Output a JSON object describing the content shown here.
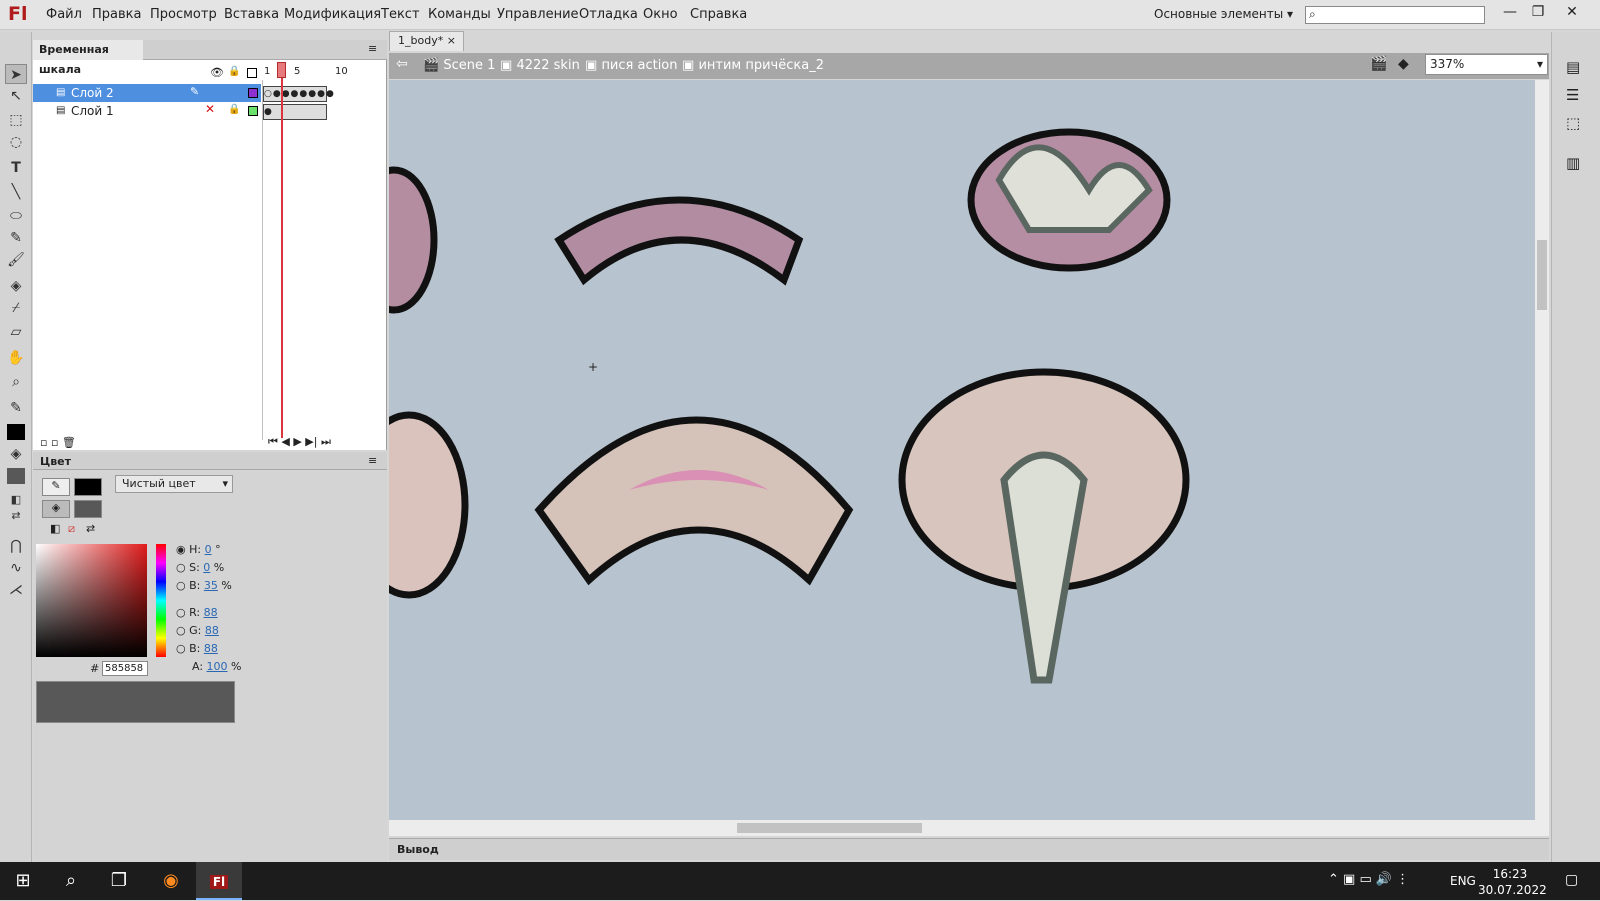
{
  "app": {
    "logo": "Fl"
  },
  "menu": [
    "Файл",
    "Правка",
    "Просмотр",
    "Вставка",
    "Модификация",
    "Текст",
    "Команды",
    "Управление",
    "Отладка",
    "Окно",
    "Справка"
  ],
  "workspace": "Основные элементы",
  "timeline": {
    "title": "Временная шкала",
    "frame_ruler": [
      "1",
      "5",
      "10"
    ],
    "layers": [
      {
        "name": "Слой 2",
        "selected": true
      },
      {
        "name": "Слой 1",
        "selected": false
      }
    ]
  },
  "color_panel": {
    "title": "Цвет",
    "fill_type": "Чистый цвет",
    "hsb": {
      "H": "0",
      "S": "0",
      "B": "35"
    },
    "rgb": {
      "R": "88",
      "G": "88",
      "B": "88"
    },
    "alpha": "100",
    "hex": "585858",
    "units": {
      "deg": "°",
      "pct": "%"
    },
    "preview_color": "#585858"
  },
  "document": {
    "tab": "1_body*",
    "breadcrumbs": [
      "Scene 1",
      "4222 skin",
      "пися action",
      "интим причёска_2"
    ],
    "zoom": "337%"
  },
  "output_label": "Вывод",
  "taskbar": {
    "lang": "ENG",
    "time": "16:23",
    "date": "30.07.2022"
  }
}
